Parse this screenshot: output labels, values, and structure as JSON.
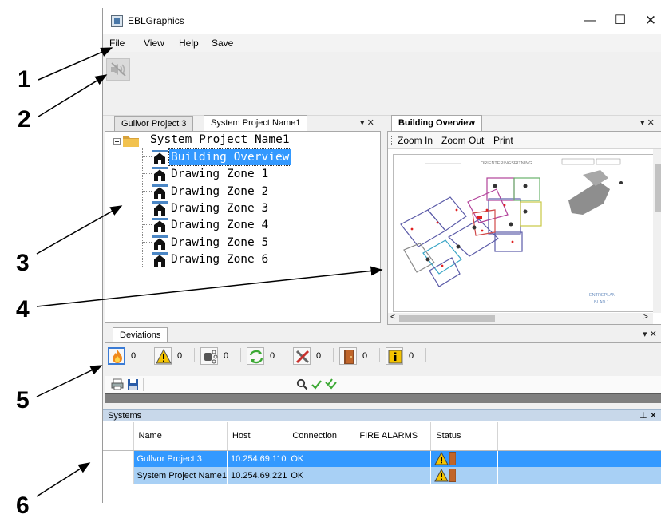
{
  "callouts": [
    "1",
    "2",
    "3",
    "4",
    "5",
    "6"
  ],
  "window": {
    "title": "EBLGraphics",
    "controls": {
      "minimize": "—",
      "maximize": "☐",
      "close": "✕"
    }
  },
  "menu": [
    "File",
    "View",
    "Help",
    "Save"
  ],
  "tree_panel": {
    "tabs": [
      "Gullvor Project 3",
      "System Project Name1"
    ],
    "root": "System Project Name1",
    "items": [
      "Building Overview",
      "Drawing Zone 1",
      "Drawing Zone 2",
      "Drawing Zone 3",
      "Drawing Zone 4",
      "Drawing Zone 5",
      "Drawing Zone 6"
    ],
    "selected_index": 0,
    "pane_controls": "▾ ✕"
  },
  "overview_panel": {
    "tab": "Building Overview",
    "menu": [
      "Zoom In",
      "Zoom Out",
      "Print"
    ],
    "drawing_text": {
      "heading": "ORIENTERINGSRITNING",
      "plan": "ENTREPLAN",
      "sheet": "BLAD 1"
    },
    "pane_controls": "▾ ✕",
    "scroll_left": "<",
    "scroll_right": ">"
  },
  "deviations": {
    "tab": "Deviations",
    "pane_controls": "▾ ✕",
    "items": [
      {
        "icon": "fire-alarm-icon",
        "count": "0"
      },
      {
        "icon": "warning-icon",
        "count": "0"
      },
      {
        "icon": "disablement-icon",
        "count": "0"
      },
      {
        "icon": "test-mode-icon",
        "count": "0"
      },
      {
        "icon": "service-tools-icon",
        "count": "0"
      },
      {
        "icon": "door-icon",
        "count": "0"
      },
      {
        "icon": "info-icon",
        "count": "0"
      }
    ]
  },
  "systems": {
    "title": "Systems",
    "pin": "⊥ ✕",
    "columns": [
      "Name",
      "Host",
      "Connection",
      "FIRE ALARMS",
      "Status"
    ],
    "rows": [
      {
        "marker": "▸",
        "name": "Gullvor Project 3",
        "host": "10.254.69.110",
        "connection": "OK",
        "fire_alarms": ""
      },
      {
        "marker": "",
        "name": "System Project Name1",
        "host": "10.254.69.221",
        "connection": "OK",
        "fire_alarms": ""
      }
    ]
  },
  "colors": {
    "selection": "#3399ff",
    "selection_light": "#a8d0f5",
    "warning": "#f5c400",
    "door": "#c0652a"
  }
}
